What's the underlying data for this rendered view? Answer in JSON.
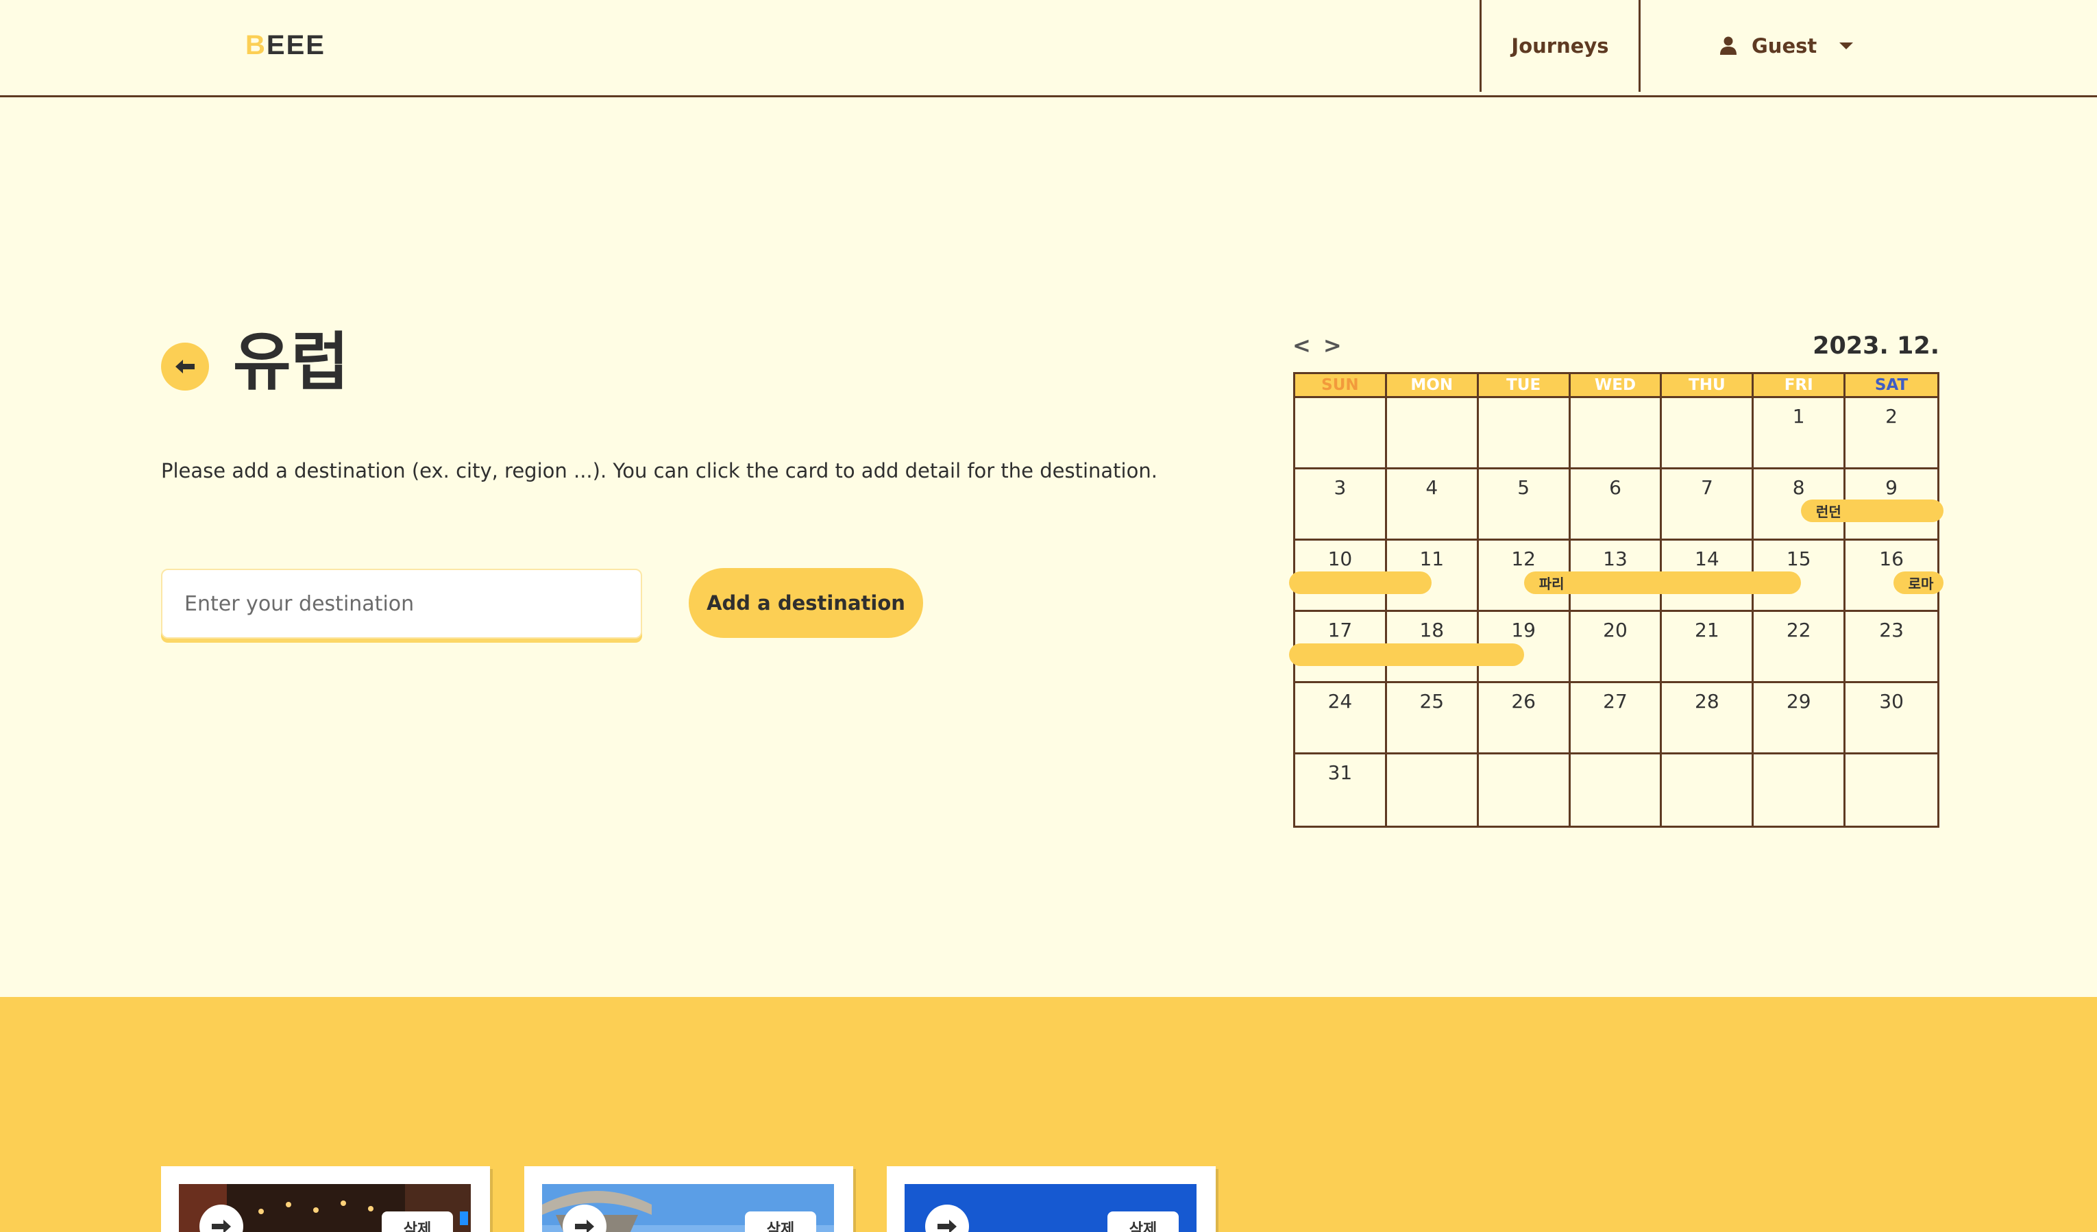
{
  "header": {
    "logo_first": "B",
    "logo_rest": "EEE",
    "nav_journeys": "Journeys",
    "nav_guest": "Guest",
    "user_icon": "user-icon",
    "dropdown_icon": "caret-down-icon"
  },
  "main": {
    "title": "유럽",
    "instruction": "Please add a destination (ex. city, region ...). You can click the card to add detail for the destination.",
    "input_placeholder": "Enter your destination",
    "add_button": "Add a destination"
  },
  "calendar": {
    "prev": "<",
    "next": ">",
    "month": "2023. 12.",
    "weekdays": [
      "SUN",
      "MON",
      "TUE",
      "WED",
      "THU",
      "FRI",
      "SAT"
    ],
    "weeks": [
      [
        "",
        "",
        "",
        "",
        "",
        "1",
        "2"
      ],
      [
        "3",
        "4",
        "5",
        "6",
        "7",
        "8",
        "9"
      ],
      [
        "10",
        "11",
        "12",
        "13",
        "14",
        "15",
        "16"
      ],
      [
        "17",
        "18",
        "19",
        "20",
        "21",
        "22",
        "23"
      ],
      [
        "24",
        "25",
        "26",
        "27",
        "28",
        "29",
        "30"
      ],
      [
        "31",
        "",
        "",
        "",
        "",
        "",
        ""
      ]
    ],
    "events": [
      {
        "label": "런던",
        "start": "2023-12-08",
        "end": "2023-12-11"
      },
      {
        "label": "파리",
        "start": "2023-12-12",
        "end": "2023-12-15"
      },
      {
        "label": "로마",
        "start": "2023-12-16",
        "end": "2023-12-19"
      }
    ],
    "colors": {
      "sun": "#f29a3c",
      "sat": "#3f5dc4",
      "accent": "#fccf54",
      "border": "#5e3a22"
    }
  },
  "cards": [
    {
      "delete_label": "삭제"
    },
    {
      "delete_label": "삭제"
    },
    {
      "delete_label": "삭제"
    }
  ]
}
